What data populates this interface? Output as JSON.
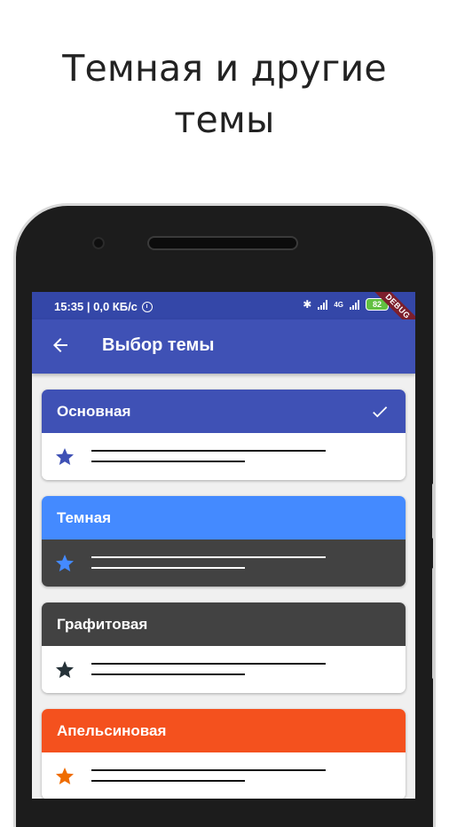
{
  "headline": {
    "line1": "Темная и другие",
    "line2": "темы"
  },
  "status_bar": {
    "time_speed": "15:35 | 0,0 КБ/с",
    "network": "4G",
    "battery": "82",
    "debug_banner": "DEBUG"
  },
  "app_bar": {
    "title": "Выбор темы"
  },
  "themes": [
    {
      "name": "Основная",
      "selected": true,
      "header_color": "#3f51b5",
      "body_color": "#ffffff",
      "star_color": "#3f51b5",
      "line_color": "#111111"
    },
    {
      "name": "Темная",
      "selected": false,
      "header_color": "#448aff",
      "body_color": "#424242",
      "star_color": "#448aff",
      "line_color": "#ffffff"
    },
    {
      "name": "Графитовая",
      "selected": false,
      "header_color": "#424242",
      "body_color": "#ffffff",
      "star_color": "#263238",
      "line_color": "#111111"
    },
    {
      "name": "Апельсиновая",
      "selected": false,
      "header_color": "#f4511e",
      "body_color": "#ffffff",
      "star_color": "#ef6c00",
      "line_color": "#111111"
    }
  ],
  "icons": [
    "back-arrow-icon",
    "check-icon",
    "star-icon",
    "bluetooth-icon",
    "signal-icon",
    "alarm-icon"
  ]
}
